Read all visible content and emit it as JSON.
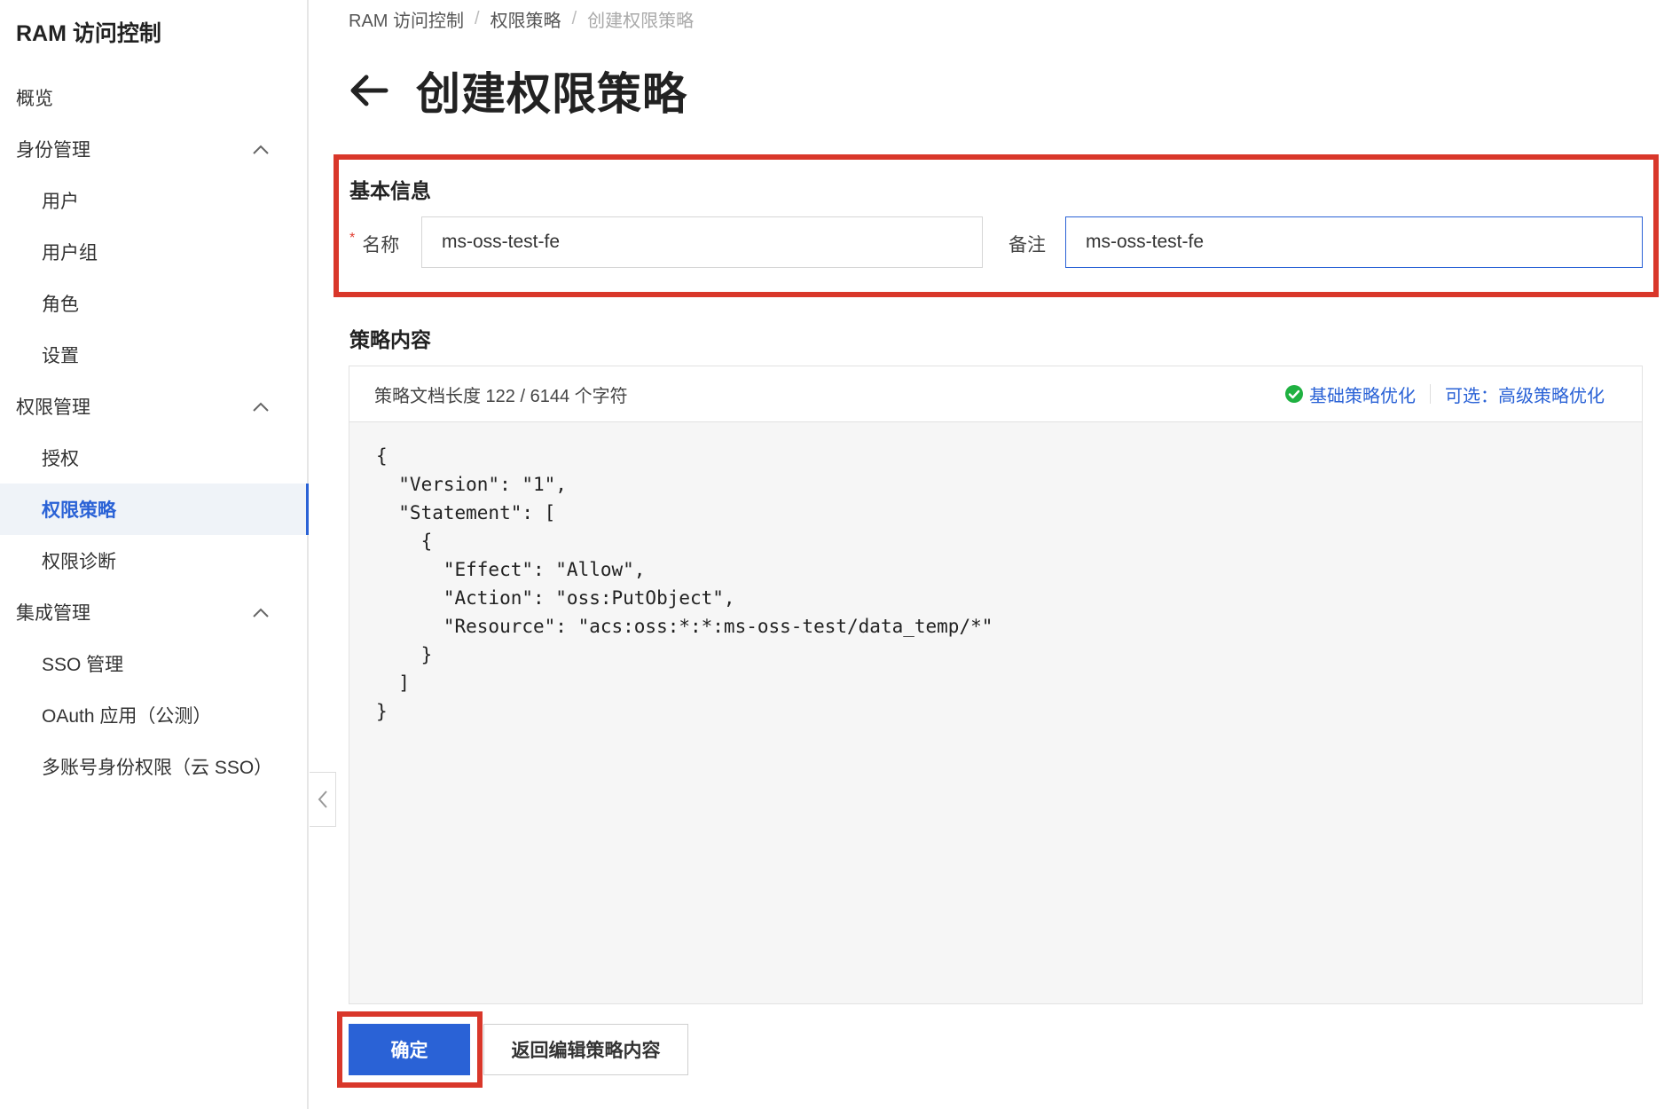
{
  "sidebar": {
    "title": "RAM 访问控制",
    "items": [
      {
        "label": "概览",
        "level": 1
      },
      {
        "label": "身份管理",
        "level": 1,
        "expandable": true
      },
      {
        "label": "用户",
        "level": 2
      },
      {
        "label": "用户组",
        "level": 2
      },
      {
        "label": "角色",
        "level": 2
      },
      {
        "label": "设置",
        "level": 2
      },
      {
        "label": "权限管理",
        "level": 1,
        "expandable": true
      },
      {
        "label": "授权",
        "level": 2
      },
      {
        "label": "权限策略",
        "level": 2,
        "active": true
      },
      {
        "label": "权限诊断",
        "level": 2
      },
      {
        "label": "集成管理",
        "level": 1,
        "expandable": true
      },
      {
        "label": "SSO 管理",
        "level": 2
      },
      {
        "label": "OAuth 应用（公测）",
        "level": 2
      },
      {
        "label": "多账号身份权限（云 SSO）",
        "level": 2
      }
    ]
  },
  "breadcrumb": [
    "RAM 访问控制",
    "权限策略",
    "创建权限策略"
  ],
  "page_title": "创建权限策略",
  "basic_info": {
    "section_title": "基本信息",
    "name_label": "名称",
    "name_value": "ms-oss-test-fe",
    "note_label": "备注",
    "note_value": "ms-oss-test-fe"
  },
  "policy": {
    "section_title": "策略内容",
    "doc_length": "策略文档长度 122 / 6144 个字符",
    "basic_optimize": "基础策略优化",
    "advanced_optimize": "可选：高级策略优化",
    "code_lines": [
      "{",
      "  \"Version\": \"1\",",
      "  \"Statement\": [",
      "    {",
      "      \"Effect\": \"Allow\",",
      "      \"Action\": \"oss:PutObject\",",
      "      \"Resource\": \"acs:oss:*:*:ms-oss-test/data_temp/*\"",
      "    }",
      "  ]",
      "}"
    ]
  },
  "buttons": {
    "confirm": "确定",
    "back_edit": "返回编辑策略内容"
  },
  "colors": {
    "primary": "#2a62d6",
    "highlight": "#d9372a",
    "success": "#1fb141"
  }
}
